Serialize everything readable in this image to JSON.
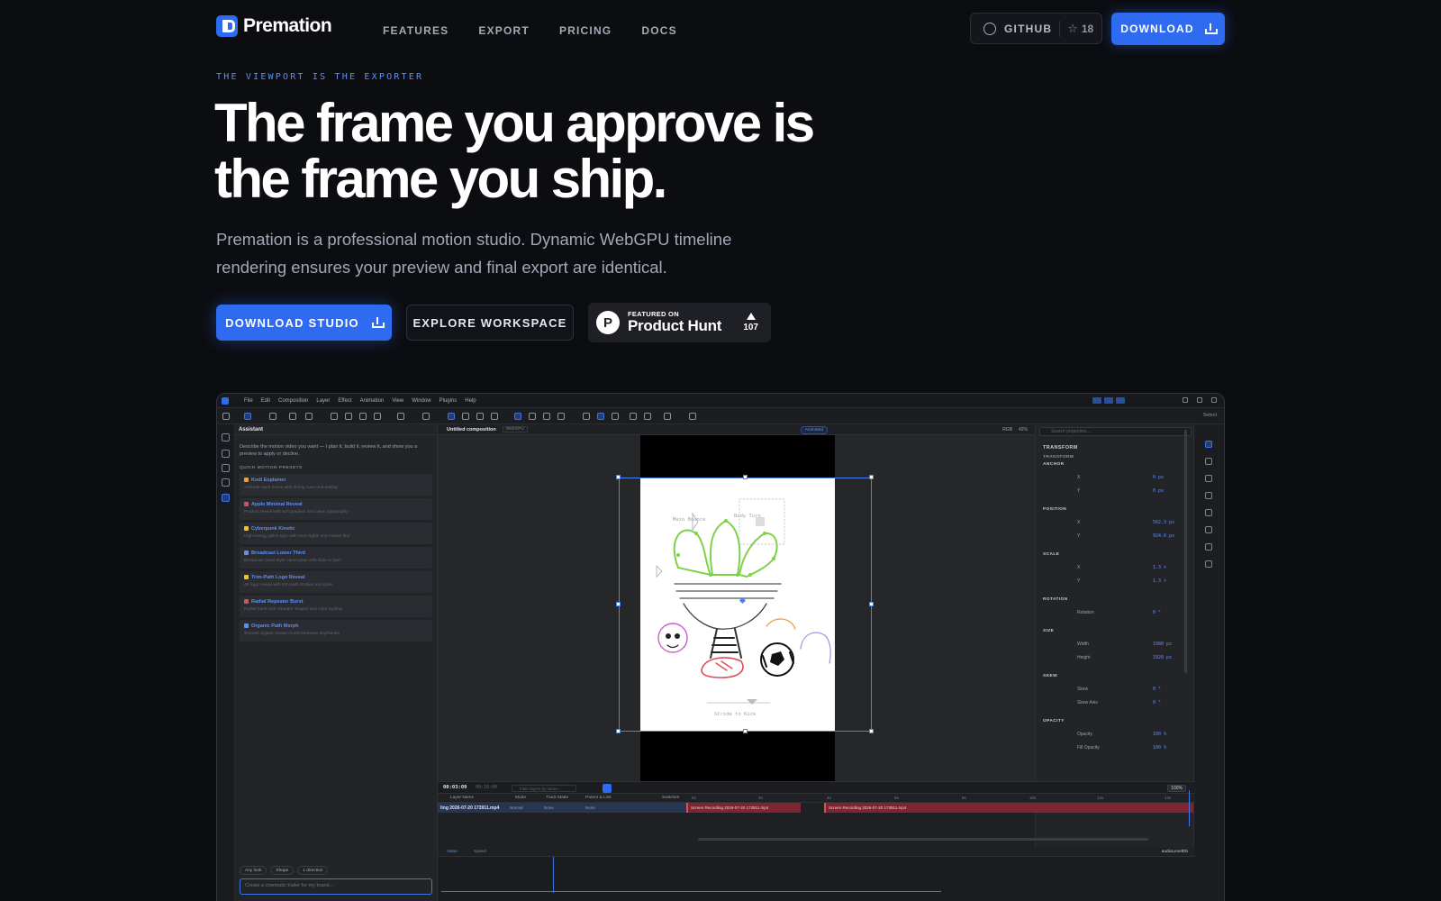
{
  "nav": {
    "logo_text": "Premation",
    "links": [
      "FEATURES",
      "EXPORT",
      "PRICING",
      "DOCS"
    ],
    "github_label": "GITHUB",
    "github_stars": "18",
    "download_label": "DOWNLOAD"
  },
  "hero": {
    "eyebrow": "THE VIEWPORT IS THE EXPORTER",
    "headline": "The frame you approve is the frame you ship.",
    "subtext": "Premation is a professional motion studio. Dynamic WebGPU timeline rendering ensures your preview and final export are identical.",
    "cta_primary": "DOWNLOAD STUDIO",
    "cta_secondary": "EXPLORE WORKSPACE",
    "product_hunt": {
      "small": "FEATURED ON",
      "big": "Product Hunt",
      "votes": "107"
    }
  },
  "app": {
    "menu": [
      "File",
      "Edit",
      "Composition",
      "Layer",
      "Effect",
      "Animation",
      "View",
      "Window",
      "Plugins",
      "Help"
    ],
    "toolbar_right": "Select",
    "assistant": {
      "title": "Assistant",
      "description": "Describe the motion video you want — I plan it, build it, review it, and show you a preview to apply or decline.",
      "quick_label": "QUICK MOTION PRESETS",
      "presets": [
        {
          "title": "Kodi Explainer",
          "desc": "Animate each scene with timing cues and easing",
          "color": "#e9a13b"
        },
        {
          "title": "Apple Minimal Reveal",
          "desc": "Product reveal with soft gradient and clean typography",
          "color": "#e04b5a"
        },
        {
          "title": "Cyberpunk Kinetic",
          "desc": "High energy glitch type with neon lights and motion blur",
          "color": "#e9c13b"
        },
        {
          "title": "Broadcast Lower Third",
          "desc": "Broadcast news-style name plate with slide-in bars",
          "color": "#5d8ef5"
        },
        {
          "title": "Trim-Path Logo Reveal",
          "desc": "4K logo reveal with trim path strokes and glow",
          "color": "#e9c13b"
        },
        {
          "title": "Radial Repeater Burst",
          "desc": "Radial burst with repeater shapes and color cycling",
          "color": "#e04b5a"
        },
        {
          "title": "Organic Path Morph",
          "desc": "Smooth organic shape morph between keyframes",
          "color": "#5d8ef5"
        }
      ],
      "chips": [
        "Any look",
        "Shape",
        "1 direction"
      ],
      "input_placeholder": "Create a cinematic trailer for my brand..."
    },
    "composition": {
      "title": "Untitled composition",
      "badge": "WebGPU",
      "animated": "Animated",
      "zoom": "42%",
      "mode": "RGB"
    },
    "canvas_labels": {
      "left": "Main Bounce",
      "top": "Body Turn",
      "bottom": "Stride to Kick"
    },
    "properties": {
      "search_placeholder": "Search properties...",
      "section": "TRANSFORM",
      "subsection": "TRANSFORM",
      "groups": [
        {
          "name": "ANCHOR",
          "rows": [
            {
              "label": "X",
              "value": "0 px"
            },
            {
              "label": "Y",
              "value": "0 px"
            }
          ]
        },
        {
          "name": "POSITION",
          "rows": [
            {
              "label": "X",
              "value": "562.3 px"
            },
            {
              "label": "Y",
              "value": "924.8 px"
            }
          ]
        },
        {
          "name": "SCALE",
          "rows": [
            {
              "label": "X",
              "value": "1.3 ×"
            },
            {
              "label": "Y",
              "value": "1.3 ×"
            }
          ]
        },
        {
          "name": "ROTATION",
          "rows": [
            {
              "label": "Rotation",
              "value": "0 °"
            }
          ]
        },
        {
          "name": "SIZE",
          "rows": [
            {
              "label": "Width",
              "value": "1080 px"
            },
            {
              "label": "Height",
              "value": "1920 px"
            }
          ]
        },
        {
          "name": "SKEW",
          "rows": [
            {
              "label": "Skew",
              "value": "0 °"
            },
            {
              "label": "Skew Axis",
              "value": "0 °"
            }
          ]
        },
        {
          "name": "OPACITY",
          "rows": [
            {
              "label": "Opacity",
              "value": "100 %"
            },
            {
              "label": "Fill Opacity",
              "value": "100 %"
            }
          ]
        }
      ]
    },
    "timeline": {
      "current_time": "00:03:09",
      "total_time": "00:18:00",
      "search_placeholder": "Filter layers by name...",
      "zoom": "100%",
      "columns": [
        "Layer Name",
        "Mode",
        "Track Matte",
        "Parent & Link",
        "Switches"
      ],
      "ticks": [
        "0s",
        "2s",
        "4s",
        "6s",
        "8s",
        "10s",
        "12s",
        "14s"
      ],
      "layer": {
        "name": "ling 2026-07-20 173911.mp4",
        "mode": "Normal",
        "matte": "None",
        "parent": "None"
      },
      "clips": [
        "Screen Recording 2026-07-20 173911.mp4",
        "Screen Recording 2026-07-20 173911.mp4"
      ],
      "graph_tabs": [
        "Value",
        "Speed"
      ],
      "graph_channel": "audioLevelDb"
    }
  }
}
